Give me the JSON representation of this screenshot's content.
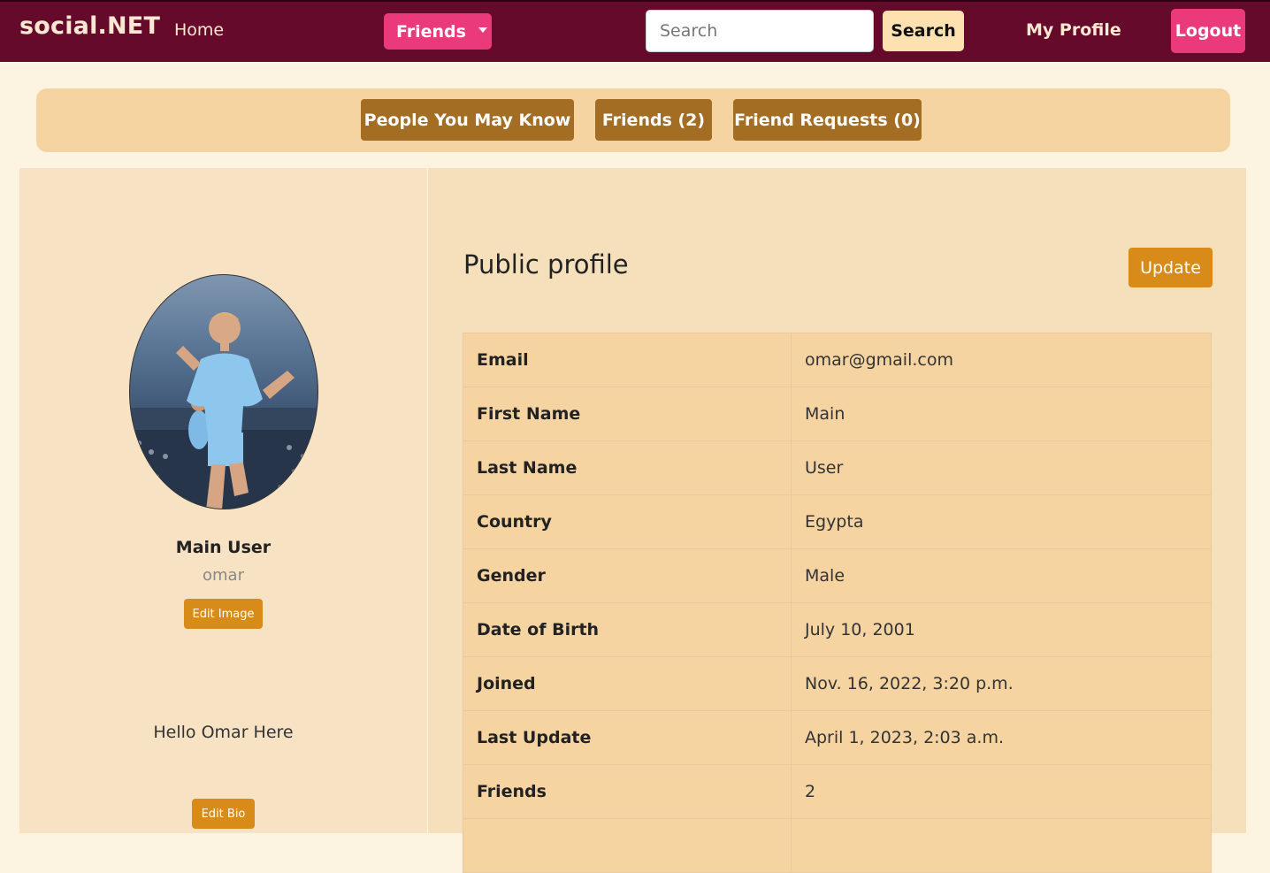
{
  "navbar": {
    "brand": "social.NET",
    "home": "Home",
    "friends_dropdown": "Friends",
    "search_placeholder": "Search",
    "search_button": "Search",
    "my_profile": "My Profile",
    "logout": "Logout"
  },
  "subnav": {
    "people": "People You May Know",
    "friends": "Friends (2)",
    "requests": "Friend Requests (0)"
  },
  "profile": {
    "full_name": "Main User",
    "username": "omar",
    "edit_image": "Edit Image",
    "bio": "Hello Omar Here",
    "edit_bio": "Edit Bio"
  },
  "public_profile": {
    "title": "Public profile",
    "update_button": "Update",
    "rows": [
      {
        "label": "Email",
        "value": "omar@gmail.com"
      },
      {
        "label": "First Name",
        "value": "Main"
      },
      {
        "label": "Last Name",
        "value": "User"
      },
      {
        "label": "Country",
        "value": "Egypta"
      },
      {
        "label": "Gender",
        "value": "Male"
      },
      {
        "label": "Date of Birth",
        "value": "July 10, 2001"
      },
      {
        "label": "Joined",
        "value": "Nov. 16, 2022, 3:20 p.m."
      },
      {
        "label": "Last Update",
        "value": "April 1, 2023, 2:03 a.m."
      },
      {
        "label": "Friends",
        "value": "2"
      },
      {
        "label": "",
        "value": ""
      }
    ]
  },
  "colors": {
    "navbar_bg": "#650a2a",
    "accent_pink": "#ea3a7c",
    "subnav_button": "#a36e24",
    "action_orange": "#d98b1a",
    "page_bg": "#fdf3e1"
  }
}
